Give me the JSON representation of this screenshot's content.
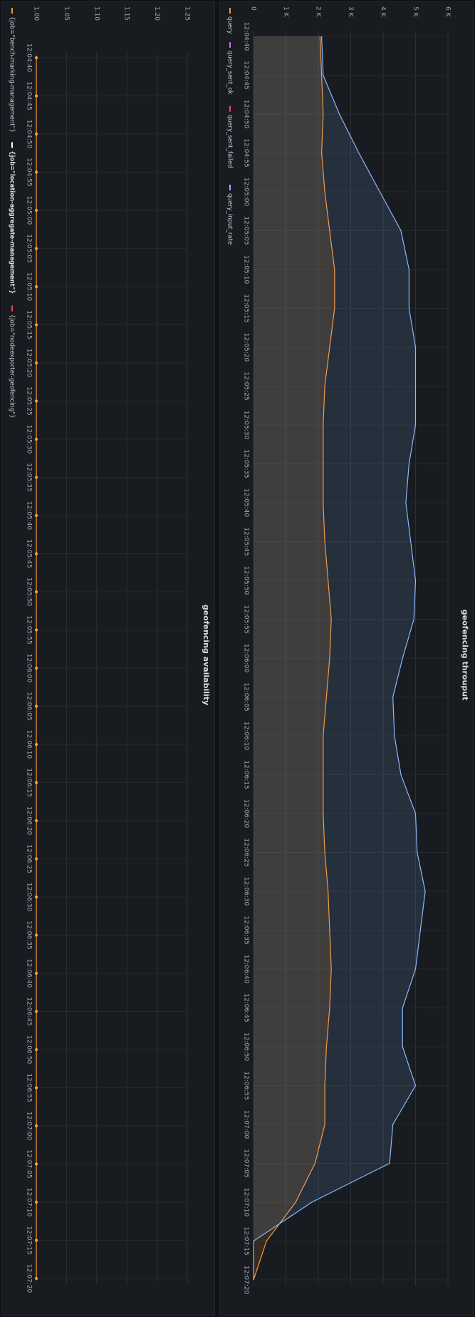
{
  "chart_data": [
    {
      "type": "area",
      "title": "geofencing throuput",
      "x": [
        "12:04:40",
        "12:04:45",
        "12:04:50",
        "12:04:55",
        "12:05:00",
        "12:05:05",
        "12:05:10",
        "12:05:15",
        "12:05:20",
        "12:05:25",
        "12:05:30",
        "12:05:35",
        "12:05:40",
        "12:05:45",
        "12:05:50",
        "12:05:55",
        "12:06:00",
        "12:06:05",
        "12:06:10",
        "12:06:15",
        "12:06:20",
        "12:06:25",
        "12:06:30",
        "12:06:35",
        "12:06:40",
        "12:06:45",
        "12:06:50",
        "12:06:55",
        "12:07:00",
        "12:07:05",
        "12:07:10",
        "12:07:15",
        "12:07:20"
      ],
      "y_ticks": [
        "0",
        "1 K",
        "2 K",
        "3 K",
        "4 K",
        "5 K",
        "6 K"
      ],
      "ylim": [
        0,
        6000
      ],
      "grid": true,
      "legend_placement": "bottom",
      "series": [
        {
          "name": "query",
          "color": "#ff9830",
          "values": [
            2050,
            2100,
            2150,
            2100,
            2200,
            2350,
            2500,
            2500,
            2350,
            2200,
            2150,
            2150,
            2150,
            2200,
            2300,
            2400,
            2350,
            2250,
            2150,
            2150,
            2150,
            2200,
            2300,
            2350,
            2400,
            2350,
            2250,
            2200,
            2200,
            1900,
            1300,
            400,
            0
          ]
        },
        {
          "name": "query_sent_ok",
          "color": "#b877d9",
          "values": []
        },
        {
          "name": "query_sent_failed",
          "color": "#f2495c",
          "values": []
        },
        {
          "name": "query_input_rate",
          "color": "#8ab8ff",
          "values": [
            2100,
            2150,
            2650,
            3250,
            3900,
            4550,
            4800,
            4800,
            5000,
            5000,
            5000,
            4800,
            4700,
            4850,
            5000,
            4950,
            4600,
            4300,
            4350,
            4550,
            5000,
            5050,
            5300,
            5150,
            5000,
            4600,
            4600,
            5000,
            4300,
            4200,
            1800,
            0,
            0
          ]
        }
      ]
    },
    {
      "type": "line",
      "title": "geofencing availability",
      "x": [
        "12:04:40",
        "12:04:45",
        "12:04:50",
        "12:04:55",
        "12:05:00",
        "12:05:05",
        "12:05:10",
        "12:05:15",
        "12:05:20",
        "12:05:25",
        "12:05:30",
        "12:05:35",
        "12:05:40",
        "12:05:45",
        "12:05:50",
        "12:05:55",
        "12:06:00",
        "12:06:05",
        "12:06:10",
        "12:06:15",
        "12:06:20",
        "12:06:25",
        "12:06:30",
        "12:06:35",
        "12:06:40",
        "12:06:45",
        "12:06:50",
        "12:06:55",
        "12:07:00",
        "12:07:05",
        "12:07:10",
        "12:07:15",
        "12:07:20"
      ],
      "y_ticks": [
        "1.00",
        "1.05",
        "1.10",
        "1.15",
        "1.20",
        "1.25"
      ],
      "ylim": [
        1.0,
        1.25
      ],
      "grid": true,
      "legend_placement": "bottom",
      "series": [
        {
          "name": "{job=\"bench-marking-management\"}",
          "color": "#ff9830",
          "values": [
            1,
            1,
            1,
            1,
            1,
            1,
            1,
            1,
            1,
            1,
            1,
            1,
            1,
            1,
            1,
            1,
            1,
            1,
            1,
            1,
            1,
            1,
            1,
            1,
            1,
            1,
            1,
            1,
            1,
            1,
            1,
            1,
            1
          ]
        },
        {
          "name": "{job=\"location-aggregate-management\"}",
          "color": "#ffffff",
          "bold": true,
          "values": []
        },
        {
          "name": "{job=\"nodeexporter-geofencing\"}",
          "color": "#f2495c",
          "values": []
        }
      ]
    }
  ]
}
